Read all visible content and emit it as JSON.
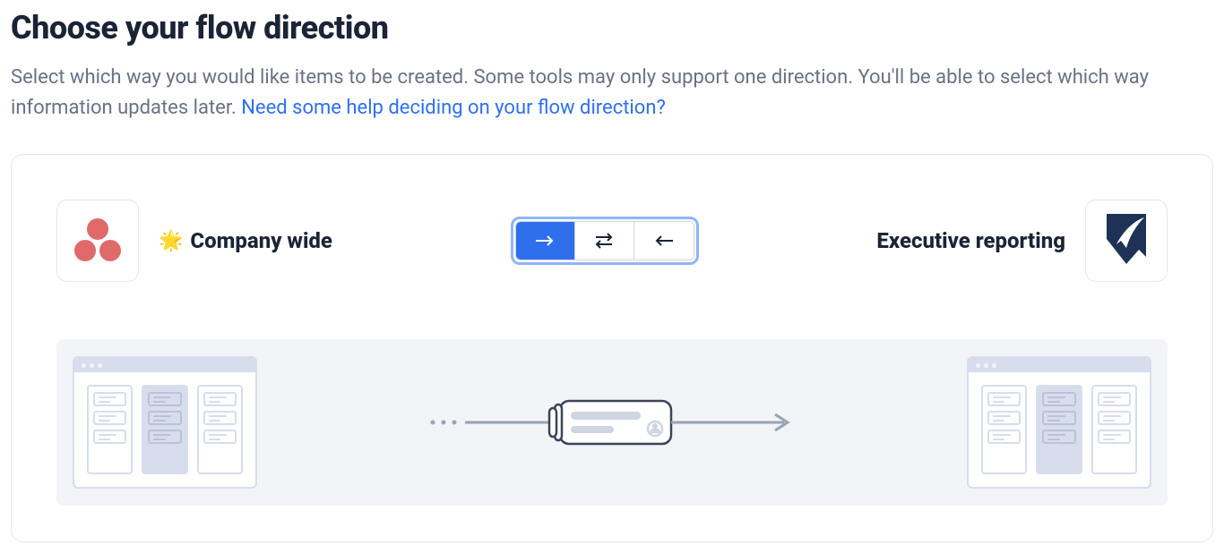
{
  "header": {
    "title": "Choose your flow direction",
    "subtitle_before": "Select which way you would like items to be created. Some tools may only support one direction. You'll be able to select which way information updates later. ",
    "help_link": "Need some help deciding on your flow direction?"
  },
  "flow": {
    "source": {
      "emoji": "🌟",
      "label": "Company wide",
      "tool_icon": "asana"
    },
    "destination": {
      "label": "Executive reporting",
      "tool_icon": "smartsheet"
    },
    "direction_selected": "one_way_right",
    "direction_options": [
      "one_way_right",
      "two_way",
      "one_way_left"
    ]
  }
}
